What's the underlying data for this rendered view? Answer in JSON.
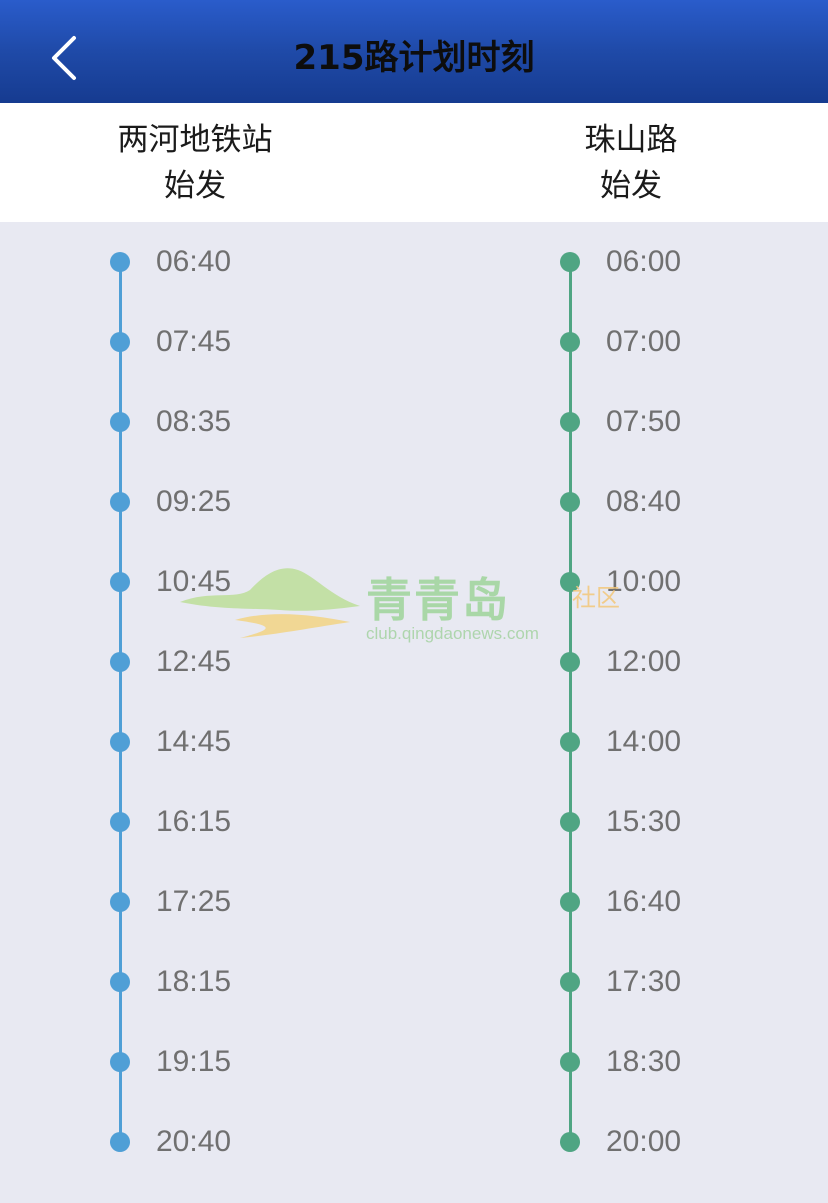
{
  "header": {
    "title": "215路计划时刻",
    "back_icon": "chevron-left-icon",
    "background": "#1f4aa8"
  },
  "terminals": {
    "left": {
      "name": "两河地铁站",
      "suffix": "始发"
    },
    "right": {
      "name": "珠山路",
      "suffix": "始发"
    }
  },
  "schedule": {
    "left": {
      "color": "#4f9fd6",
      "times": [
        "06:40",
        "07:45",
        "08:35",
        "09:25",
        "10:45",
        "12:45",
        "14:45",
        "16:15",
        "17:25",
        "18:15",
        "19:15",
        "20:40"
      ]
    },
    "right": {
      "color": "#4fa583",
      "times": [
        "06:00",
        "07:00",
        "07:50",
        "08:40",
        "10:00",
        "12:00",
        "14:00",
        "15:30",
        "16:40",
        "17:30",
        "18:30",
        "20:00"
      ]
    }
  },
  "watermark": {
    "brand": "青青岛",
    "tag": "社区",
    "url": "club.qingdaonews.com"
  }
}
